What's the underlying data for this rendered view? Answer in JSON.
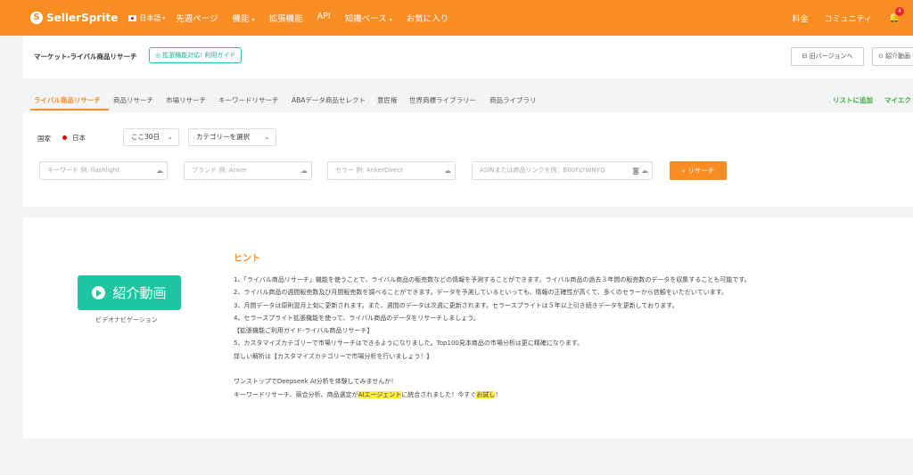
{
  "topbar": {
    "logo_text": "SellerSprite",
    "language": "日本語",
    "nav_items": [
      "先週ページ",
      "機能",
      "拡張機能",
      "API",
      "知識ベース",
      "お気に入り"
    ],
    "right_items": [
      "料金",
      "コミュニティ"
    ],
    "notification_count": "4"
  },
  "subheader": {
    "title": "マーケット-ライバル商品リサーチ",
    "badge": "拡張機能対応! 利用ガイド",
    "old_version": "旧バージョンへ",
    "intro_button": "紹介動画"
  },
  "tabs": [
    "ライバル商品リサーチ",
    "商品リサーチ",
    "市場リサーチ",
    "キーワードリサーチ",
    "ABAデータ商品セレクト",
    "意匠権",
    "世界商標ライブラリー",
    "商品ライブラリ"
  ],
  "tabs_right": [
    "リストに追加",
    "マイエク"
  ],
  "search": {
    "site_label": "国家",
    "site_value": "日本",
    "period": "ここ30日",
    "category_placeholder": "カテゴリーを選択",
    "keyword_placeholder": "キーワード 例: flashlight",
    "brand_placeholder": "ブランド 例: Anker",
    "seller_placeholder": "セラー 例: AnkerDirect",
    "asin_placeholder": "ASINまたは商品リンクを例：B00FLYWNYQ",
    "search_button": "リサーチ"
  },
  "hint": {
    "video_button": "紹介動画",
    "video_caption": "ビデオナビゲーション",
    "title": "ヒント",
    "lines": [
      "1、「ライバル商品リサーチ」機能を使うことで、ライバル商品の販売数などの情報を予測することができます。ライバル商品の過去３年間の販売数のデータを収集することも可能です。",
      "2、ライバル商品の週間販売数及び月間販売数を調べることができます。データを予測しているといっても、情報の正確性が高くて、多くのセラーから信頼をいただいています。",
      "3、月間データは原則翌月上旬に更新されます。また、週間のデータは次週に更新されます。セラースプライトは５年以上引き続きデータを更新しております。",
      "4、セラースプライト拡張機能を使って、ライバル商品のデータをリサーチしましょう。",
      "【拡張機能ご利用ガイド-ライバル商品リサーチ】",
      "5、カスタマイズカテゴリーで市場リサーチはできるようになりました。Top100見本商品の市場分析は更に精確になります。",
      "詳しい解析は【カスタマイズカテゴリーで市場分析を行いましょう！】",
      "",
      "ワンストップでDeepseek AI分析を体験してみませんか！"
    ],
    "last_line_prefix": "キーワードリサーチ、競合分析、商品選定が",
    "last_line_highlight1": "AIエージェント",
    "last_line_middle": "に統合されました！今すぐ",
    "last_line_highlight2": "お試し",
    "last_line_suffix": "！"
  }
}
